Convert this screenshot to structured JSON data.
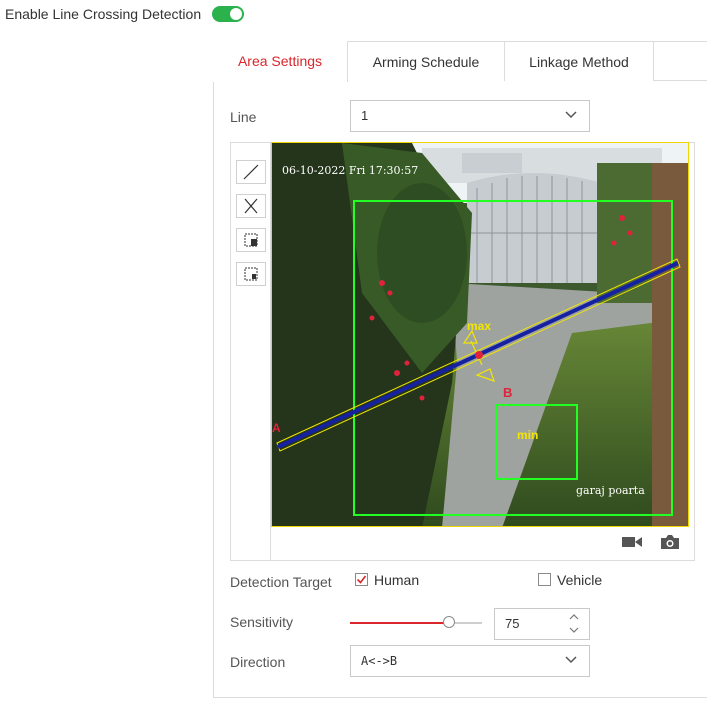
{
  "colors": {
    "accent_red": "#d9262b",
    "toggle_green": "#2bb24c",
    "zone_green": "#22ff22",
    "line_blue": "#1521a0",
    "frame_yellow": "#f2d600"
  },
  "header": {
    "enable_label": "Enable Line Crossing Detection",
    "enable_on": true
  },
  "tabs": [
    {
      "label": "Area Settings",
      "active": true
    },
    {
      "label": "Arming Schedule",
      "active": false
    },
    {
      "label": "Linkage Method",
      "active": false
    }
  ],
  "line": {
    "label": "Line",
    "value": "1"
  },
  "tools": [
    "draw-line-icon",
    "clear-icon",
    "max-size-icon",
    "min-size-icon"
  ],
  "video": {
    "timestamp": "06-10-2022 Fri 17:30:57",
    "camera_name": "garaj poarta",
    "point_a": "A",
    "point_b": "B",
    "max_label": "max",
    "min_label": "min",
    "icons": [
      "record-icon",
      "capture-icon"
    ]
  },
  "detection_target": {
    "label": "Detection Target",
    "human_label": "Human",
    "human_checked": true,
    "vehicle_label": "Vehicle",
    "vehicle_checked": false
  },
  "sensitivity": {
    "label": "Sensitivity",
    "value": "75",
    "fraction": 0.75
  },
  "direction": {
    "label": "Direction",
    "value": "A<->B"
  }
}
